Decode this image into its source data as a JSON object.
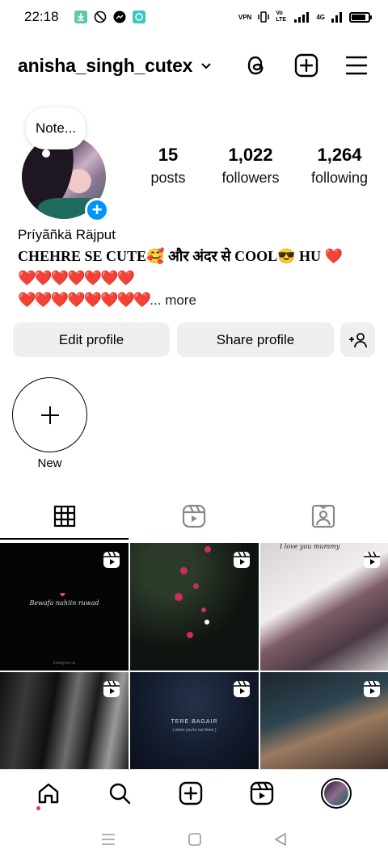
{
  "status_bar": {
    "time": "22:18",
    "network": "4G",
    "vpn": "VPN",
    "volte": "Vo LTE",
    "battery_level": 0.85
  },
  "header": {
    "username": "anisha_singh_cutex"
  },
  "profile": {
    "note": "Note...",
    "stats": [
      {
        "value": "15",
        "label": "posts"
      },
      {
        "value": "1,022",
        "label": "followers"
      },
      {
        "value": "1,264",
        "label": "following"
      }
    ],
    "full_name": "Príyãñkä Räjput",
    "bio_line1": "CHEHRE SE CUTE🥰 और अंदर से COOL😎 HU  ❤️",
    "bio_line2": "❤️❤️❤️❤️❤️❤️❤️",
    "bio_line3": "❤️❤️❤️❤️❤️❤️❤️❤️",
    "more": "... more"
  },
  "actions": {
    "edit_profile": "Edit profile",
    "share_profile": "Share profile"
  },
  "highlights": {
    "new_label": "New"
  },
  "posts": [
    {
      "text": "Bewafa nahiin ruwad",
      "handle": "instagram.ai"
    },
    {
      "text": ""
    },
    {
      "text": "I love you mummy"
    },
    {
      "text": ""
    },
    {
      "title": "TERE BAGAIR",
      "subtitle": "( when you're not there )"
    },
    {
      "text": ""
    }
  ],
  "colors": {
    "accent_blue": "#0095f6",
    "button_bg": "#efefef",
    "notification_red": "#ff3040"
  }
}
